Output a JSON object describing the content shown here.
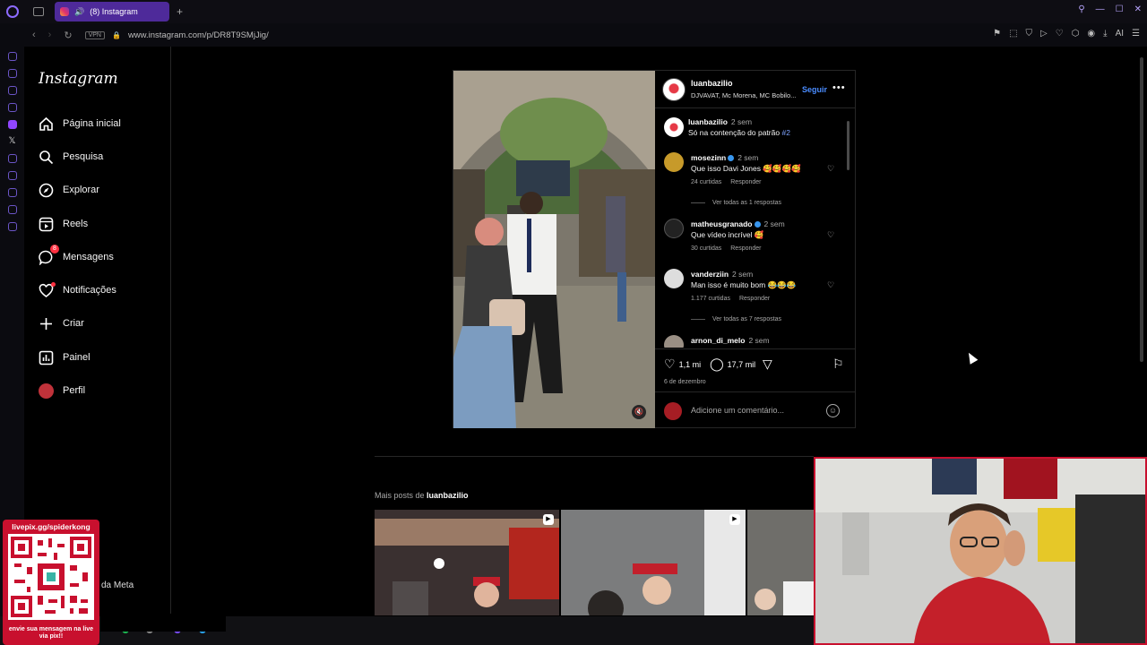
{
  "browser": {
    "tab_title": "(8) Instagram",
    "url": "www.instagram.com/p/DR8T9SMjJig/",
    "vpn_label": "VPN",
    "ai_label": "AI"
  },
  "instagram": {
    "logo": "Instagram",
    "nav": [
      {
        "label": "Página inicial",
        "icon": "home-icon"
      },
      {
        "label": "Pesquisa",
        "icon": "search-icon"
      },
      {
        "label": "Explorar",
        "icon": "compass-icon"
      },
      {
        "label": "Reels",
        "icon": "reels-icon"
      },
      {
        "label": "Mensagens",
        "icon": "messenger-icon",
        "badge": "8"
      },
      {
        "label": "Notificações",
        "icon": "heart-icon"
      },
      {
        "label": "Criar",
        "icon": "plus-icon"
      },
      {
        "label": "Painel",
        "icon": "dashboard-icon"
      },
      {
        "label": "Perfil",
        "icon": "profile-avatar-icon"
      }
    ],
    "meta_text": "da Meta"
  },
  "post": {
    "author": "luanbazilio",
    "music": "DJVAVAT, Mc Morena, MC Bobilo...",
    "follow_label": "Seguir",
    "caption": {
      "user": "luanbazilio",
      "time": "2 sem",
      "text": "Só na contenção do patrão",
      "tag": "#2"
    },
    "comments": [
      {
        "user": "mosezinn",
        "time": "2 sem",
        "text": "Que isso Davi Jones 🥰🥰🥰🥰",
        "likes": "24 curtidas",
        "reply": "Responder",
        "replies": "Ver todas as 1 respostas"
      },
      {
        "user": "matheusgranado",
        "time": "2 sem",
        "text": "Que vídeo incrível 🥰",
        "likes": "30 curtidas",
        "reply": "Responder",
        "replies": ""
      },
      {
        "user": "vanderziin",
        "time": "2 sem",
        "text": "Man isso é muito bom 😂😂😂",
        "likes": "1.177 curtidas",
        "reply": "Responder",
        "replies": "Ver todas as 7 respostas"
      },
      {
        "user": "arnon_di_melo",
        "time": "2 sem",
        "text": "",
        "likes": "",
        "reply": "",
        "replies": ""
      }
    ],
    "likes_count": "1,1 mi",
    "comments_count": "17,7 mil",
    "date": "6 de dezembro",
    "add_comment_placeholder": "Adicione um comentário..."
  },
  "more_posts": {
    "prefix": "Mais posts de",
    "user": "luanbazilio"
  },
  "overlay": {
    "qr_title": "livepix.gg/spiderkong",
    "qr_footer": "envie sua mensagem na live via pix!!"
  }
}
